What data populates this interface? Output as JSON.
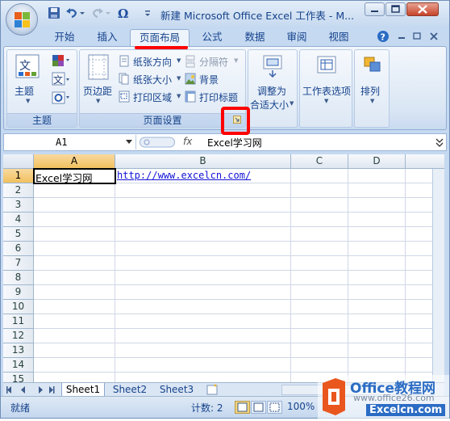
{
  "window": {
    "title": "新建 Microsoft Office Excel 工作表 - M..."
  },
  "qat": {
    "icons": [
      "save-icon",
      "undo-icon",
      "redo-icon",
      "omega-icon",
      "customize-icon"
    ]
  },
  "tabs": [
    {
      "label": "开始",
      "active": false
    },
    {
      "label": "插入",
      "active": false
    },
    {
      "label": "页面布局",
      "active": true
    },
    {
      "label": "公式",
      "active": false
    },
    {
      "label": "数据",
      "active": false
    },
    {
      "label": "审阅",
      "active": false
    },
    {
      "label": "视图",
      "active": false
    }
  ],
  "ribbon": {
    "themes": {
      "label": "主题",
      "button": "主题"
    },
    "page_setup": {
      "label": "页面设置",
      "margins": "页边距",
      "orientation": "纸张方向",
      "size": "纸张大小",
      "print_area": "打印区域",
      "breaks": "分隔符",
      "background": "背景",
      "print_titles": "打印标题"
    },
    "scale": {
      "line1": "调整为",
      "line2": "合适大小"
    },
    "sheet_options": {
      "label": "工作表选项"
    },
    "arrange": {
      "label": "排列"
    }
  },
  "formula_bar": {
    "name_box": "A1",
    "fx": "fx",
    "value": "Excel学习网"
  },
  "grid": {
    "columns": [
      "A",
      "B",
      "C",
      "D"
    ],
    "rows": [
      "1",
      "2",
      "3",
      "4",
      "5",
      "6",
      "7",
      "8",
      "9",
      "10",
      "11",
      "12",
      "13",
      "14",
      "15"
    ],
    "cells": {
      "A1": "Excel学习网",
      "B1": "http://www.excelcn.com/"
    }
  },
  "sheets": [
    {
      "label": "Sheet1",
      "active": true
    },
    {
      "label": "Sheet2",
      "active": false
    },
    {
      "label": "Sheet3",
      "active": false
    }
  ],
  "status": {
    "ready": "就绪",
    "count": "计数: 2",
    "zoom": "100%"
  },
  "watermark": {
    "line1": "Office教程网",
    "line2": "www.office26.com",
    "line3": "Excelcn.com"
  },
  "colors": {
    "accent": "#15428b",
    "highlight": "#ff0000",
    "selected_header": "#f1c15f"
  }
}
